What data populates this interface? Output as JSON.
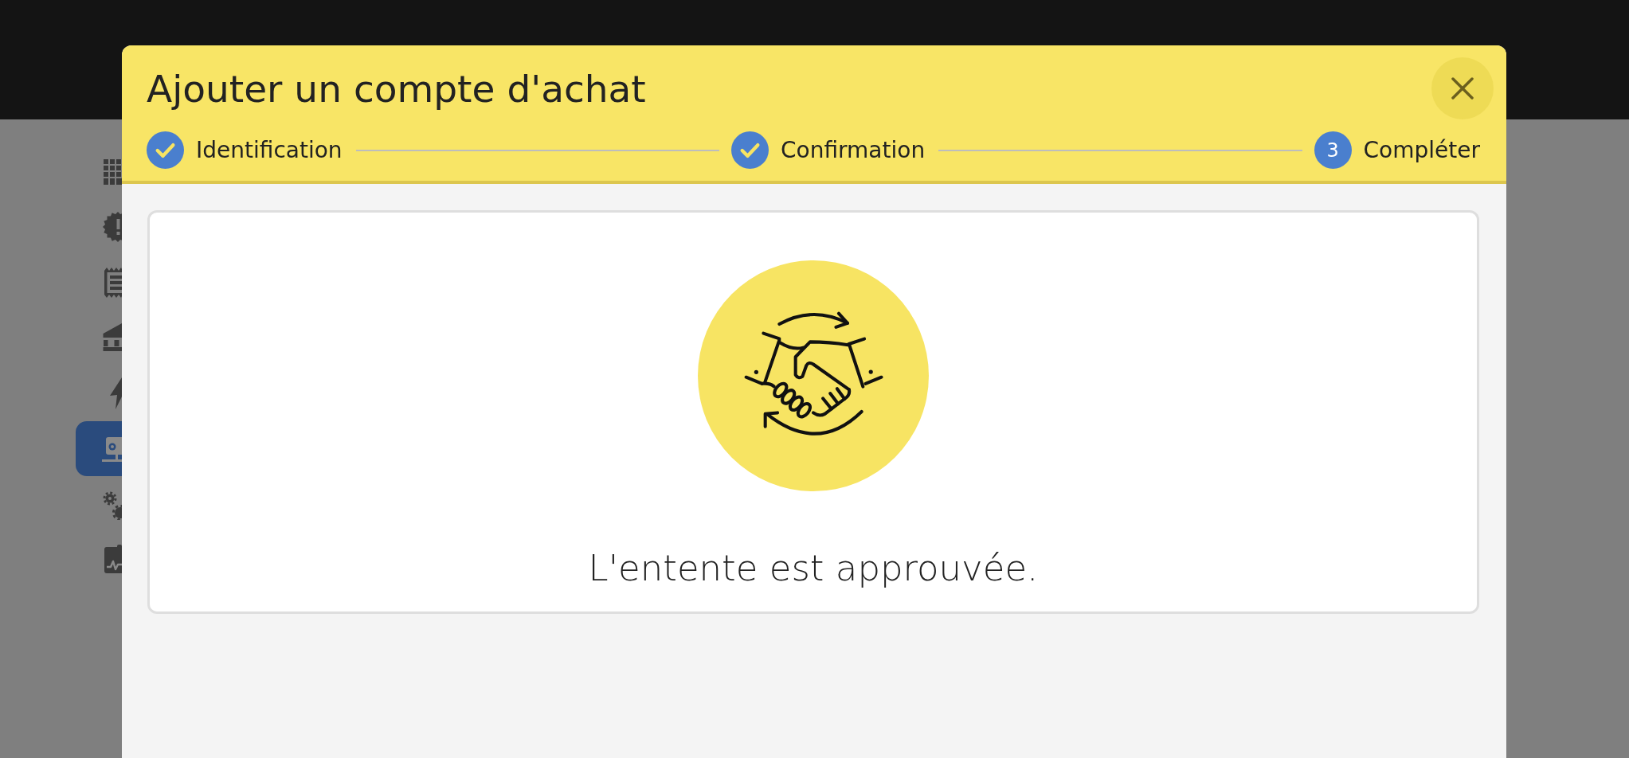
{
  "sidebar": {
    "items": [
      {
        "selected": false
      },
      {
        "selected": false
      },
      {
        "selected": false
      },
      {
        "selected": false
      },
      {
        "selected": false
      },
      {
        "selected": true
      },
      {
        "selected": false
      },
      {
        "selected": false
      }
    ]
  },
  "dialog": {
    "title": "Ajouter un compte d'achat",
    "steps": [
      {
        "label": "Identification",
        "completed": true
      },
      {
        "label": "Confirmation",
        "completed": true
      },
      {
        "number": "3",
        "label": "Compléter",
        "completed": false
      }
    ],
    "message": "L'entente est approuvée."
  }
}
